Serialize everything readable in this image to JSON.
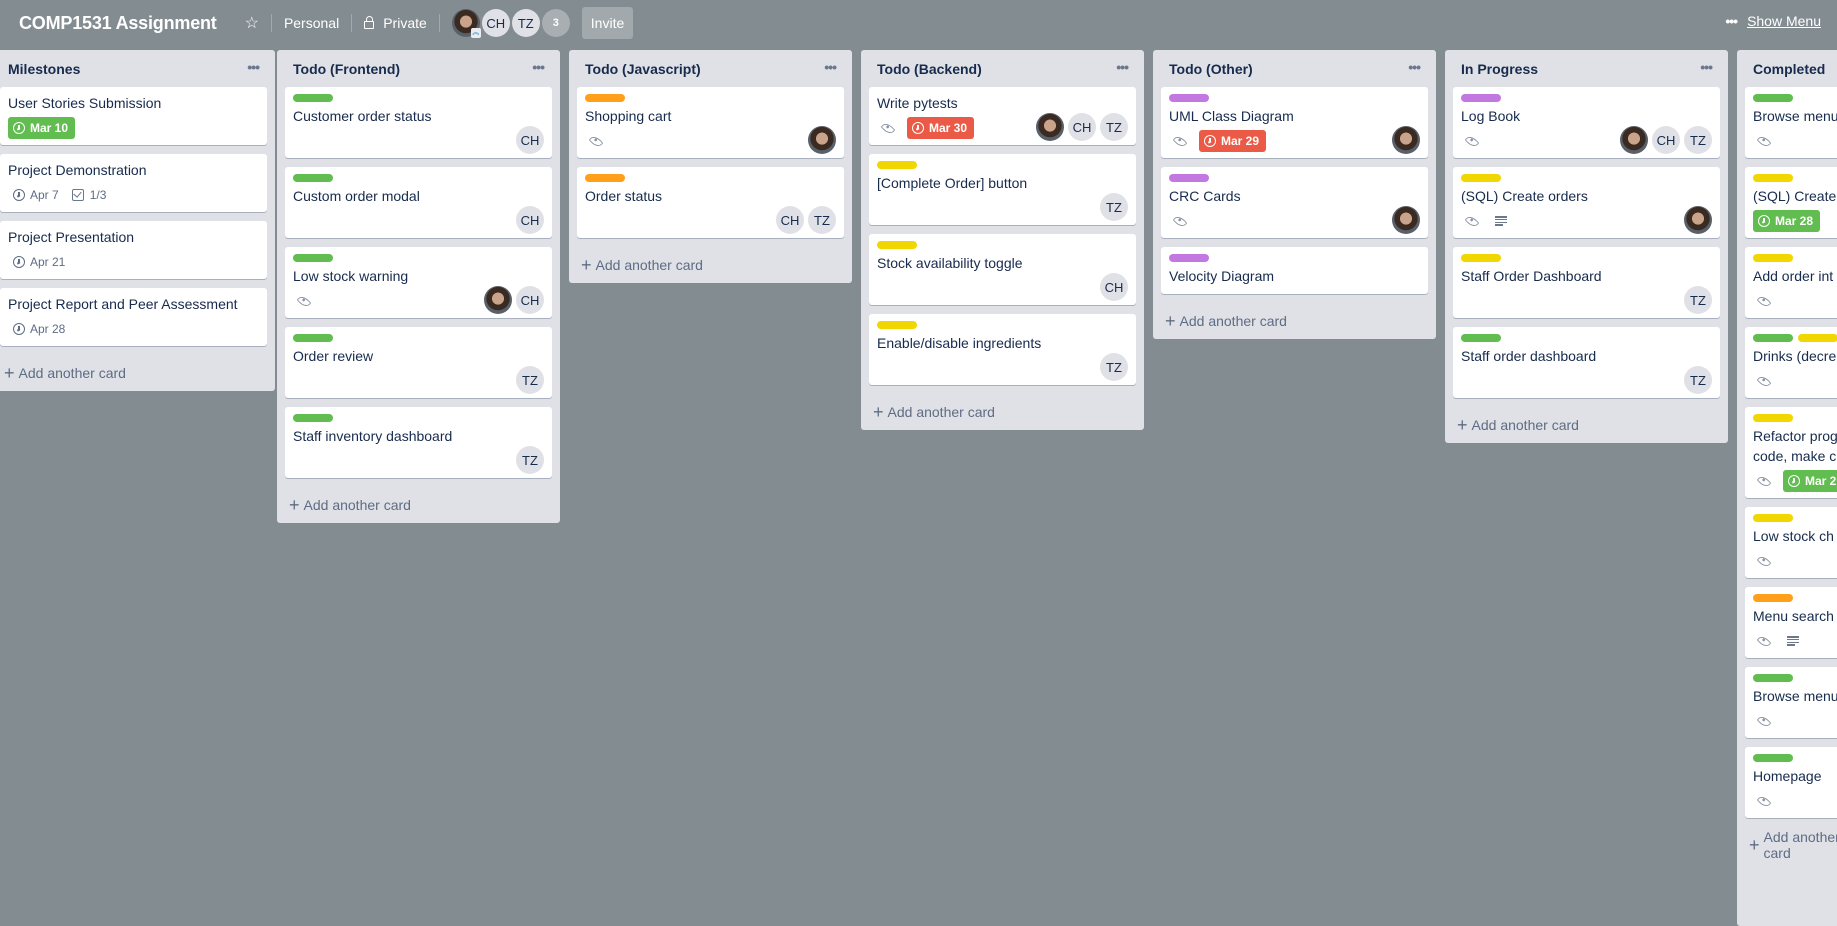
{
  "header": {
    "title": "COMP1531 Assignment",
    "star_icon": "star-icon",
    "team": "Personal",
    "visibility": "Private",
    "members": [
      "CH",
      "TZ"
    ],
    "member_count": "3",
    "invite_label": "Invite",
    "show_menu_label": "Show Menu"
  },
  "colors": {
    "green": "#61bd4f",
    "yellow": "#f2d600",
    "orange": "#ff9f1a",
    "purple": "#c377e0",
    "red": "#eb5a46",
    "board_bg": "#838c91",
    "list_bg": "#dfe1e6"
  },
  "add_card_label": "Add another card",
  "lists": [
    {
      "title": "Milestones",
      "cards": [
        {
          "title": "User Stories Submission",
          "labels": [],
          "watch": false,
          "desc": false,
          "due": {
            "text": "Mar 10",
            "state": "green"
          },
          "members": []
        },
        {
          "title": "Project Demonstration",
          "labels": [],
          "watch": false,
          "desc": false,
          "due": {
            "text": "Apr 7",
            "state": "plain"
          },
          "checklist": "1/3",
          "members": []
        },
        {
          "title": "Project Presentation",
          "labels": [],
          "watch": false,
          "desc": false,
          "due": {
            "text": "Apr 21",
            "state": "plain"
          },
          "members": []
        },
        {
          "title": "Project Report and Peer Assessment",
          "labels": [],
          "watch": false,
          "desc": false,
          "due": {
            "text": "Apr 28",
            "state": "plain"
          },
          "members": []
        }
      ]
    },
    {
      "title": "Todo (Frontend)",
      "cards": [
        {
          "title": "Customer order status",
          "labels": [
            "green"
          ],
          "watch": false,
          "members": [
            "CH"
          ]
        },
        {
          "title": "Custom order modal",
          "labels": [
            "green"
          ],
          "watch": false,
          "members": [
            "CH"
          ]
        },
        {
          "title": "Low stock warning",
          "labels": [
            "green"
          ],
          "watch": true,
          "members": [
            "photo",
            "CH"
          ]
        },
        {
          "title": "Order review",
          "labels": [
            "green"
          ],
          "watch": false,
          "members": [
            "TZ"
          ]
        },
        {
          "title": "Staff inventory dashboard",
          "labels": [
            "green"
          ],
          "watch": false,
          "members": [
            "TZ"
          ]
        }
      ]
    },
    {
      "title": "Todo (Javascript)",
      "cards": [
        {
          "title": "Shopping cart",
          "labels": [
            "orange"
          ],
          "watch": true,
          "members": [
            "photo"
          ]
        },
        {
          "title": "Order status",
          "labels": [
            "orange"
          ],
          "watch": false,
          "members": [
            "CH",
            "TZ"
          ]
        }
      ]
    },
    {
      "title": "Todo (Backend)",
      "cards": [
        {
          "title": "Write pytests",
          "labels": [],
          "watch": true,
          "due": {
            "text": "Mar 30",
            "state": "red"
          },
          "members": [
            "photo",
            "CH",
            "TZ"
          ]
        },
        {
          "title": "[Complete Order] button",
          "labels": [
            "yellow"
          ],
          "watch": false,
          "members": [
            "TZ"
          ]
        },
        {
          "title": "Stock availability toggle",
          "labels": [
            "yellow"
          ],
          "watch": false,
          "members": [
            "CH"
          ]
        },
        {
          "title": "Enable/disable ingredients",
          "labels": [
            "yellow"
          ],
          "watch": false,
          "members": [
            "TZ"
          ]
        }
      ]
    },
    {
      "title": "Todo (Other)",
      "cards": [
        {
          "title": "UML Class Diagram",
          "labels": [
            "purple"
          ],
          "watch": true,
          "due": {
            "text": "Mar 29",
            "state": "red"
          },
          "members": [
            "photo"
          ]
        },
        {
          "title": "CRC Cards",
          "labels": [
            "purple"
          ],
          "watch": true,
          "members": [
            "photo"
          ]
        },
        {
          "title": "Velocity Diagram",
          "labels": [
            "purple"
          ],
          "watch": false,
          "members": []
        }
      ]
    },
    {
      "title": "In Progress",
      "cards": [
        {
          "title": "Log Book",
          "labels": [
            "purple"
          ],
          "watch": true,
          "members": [
            "photo",
            "CH",
            "TZ"
          ]
        },
        {
          "title": "(SQL) Create orders",
          "labels": [
            "yellow"
          ],
          "watch": true,
          "desc": true,
          "members": [
            "photo"
          ]
        },
        {
          "title": "Staff Order Dashboard",
          "labels": [
            "yellow"
          ],
          "watch": false,
          "members": [
            "TZ"
          ]
        },
        {
          "title": "Staff order dashboard",
          "labels": [
            "green"
          ],
          "watch": false,
          "members": [
            "TZ"
          ]
        }
      ]
    },
    {
      "title": "Completed",
      "cards": [
        {
          "title": "Browse menu",
          "labels": [
            "green"
          ],
          "watch": true,
          "members": []
        },
        {
          "title": "(SQL) Create",
          "labels": [
            "yellow"
          ],
          "watch": false,
          "due": {
            "text": "Mar 28",
            "state": "green"
          },
          "members": []
        },
        {
          "title": "Add order int",
          "labels": [
            "yellow"
          ],
          "watch": true,
          "members": []
        },
        {
          "title": "Drinks (decre",
          "labels": [
            "green",
            "yellow"
          ],
          "watch": true,
          "members": []
        },
        {
          "title": "Refactor prog code, make c",
          "labels": [
            "yellow"
          ],
          "watch": true,
          "due": {
            "text": "Mar 2",
            "state": "green"
          },
          "members": []
        },
        {
          "title": "Low stock ch",
          "labels": [
            "yellow"
          ],
          "watch": true,
          "members": []
        },
        {
          "title": "Menu search",
          "labels": [
            "orange"
          ],
          "watch": true,
          "desc": true,
          "members": []
        },
        {
          "title": "Browse menu",
          "labels": [
            "green"
          ],
          "watch": true,
          "members": []
        },
        {
          "title": "Homepage",
          "labels": [
            "green"
          ],
          "watch": true,
          "members": []
        }
      ]
    }
  ]
}
